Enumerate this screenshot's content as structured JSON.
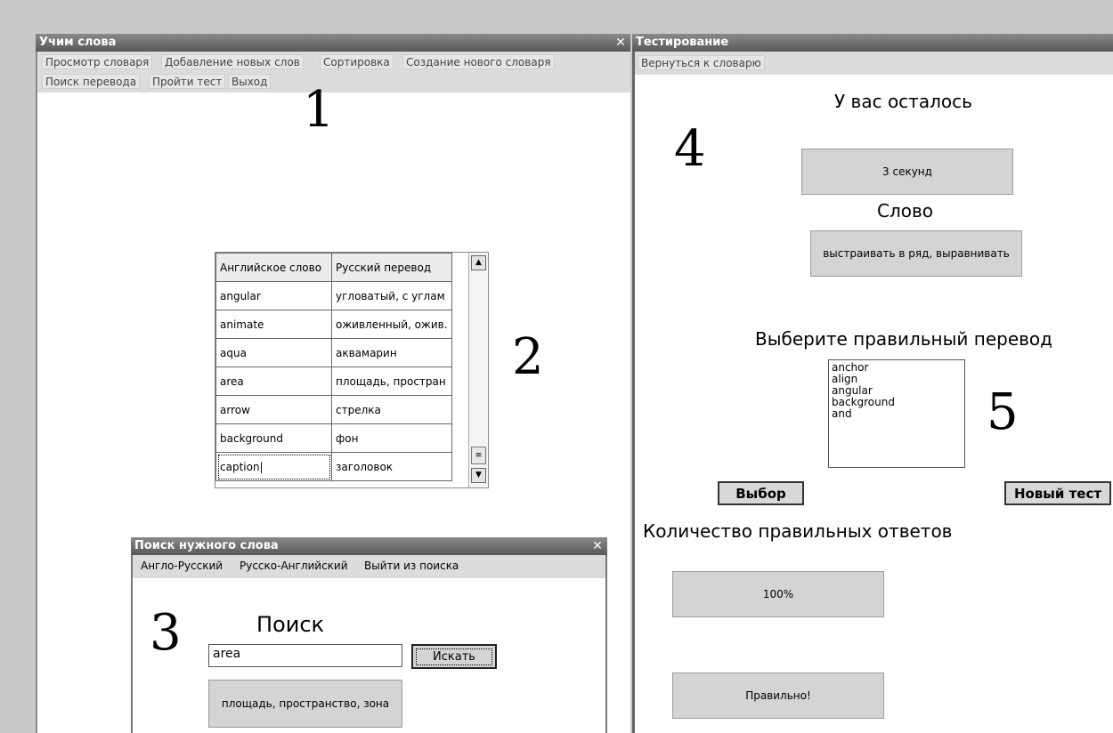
{
  "main_window": {
    "title": "Учим слова",
    "menu": [
      "Просмотр словаря",
      "Добавление новых слов",
      "Сортировка",
      "Создание нового словаря",
      "Поиск перевода",
      "Пройти тест",
      "Выход"
    ]
  },
  "markers": [
    "1",
    "2",
    "3",
    "4",
    "5"
  ],
  "dictionary_table": {
    "headers": [
      "Английское слово",
      "Русский перевод"
    ],
    "rows": [
      [
        "angular",
        "угловатый, с углам"
      ],
      [
        "animate",
        "оживленный, ожив."
      ],
      [
        "aqua",
        "аквамарин"
      ],
      [
        "area",
        "площадь, простран"
      ],
      [
        "arrow",
        "стрелка"
      ],
      [
        "background",
        "фон"
      ],
      [
        "caption|",
        "заголовок"
      ]
    ]
  },
  "search_window": {
    "title": "Поиск нужного слова",
    "menu": [
      "Англо-Русский",
      "Русско-Английский",
      "Выйти из поиска"
    ],
    "heading": "Поиск",
    "input_value": "area",
    "search_button": "Искать",
    "result": "площадь, пространство, зона"
  },
  "test_window": {
    "title": "Тестирование",
    "menu": [
      "Вернуться к словарю"
    ],
    "remaining_label": "У вас осталось",
    "remaining_value": "3 секунд",
    "word_label": "Слово",
    "word_value": "выстраивать в ряд, выравнивать",
    "choose_label": "Выберите правильный перевод",
    "options": [
      "anchor",
      "align",
      "angular",
      "background",
      "and"
    ],
    "select_button": "Выбор",
    "new_test_button": "Новый тест",
    "correct_label": "Количество правильных ответов",
    "correct_value": "100%",
    "verdict": "Правильно!"
  },
  "icons": {
    "close": "close-icon",
    "scroll_up": "scroll-up-icon",
    "scroll_down": "scroll-down-icon"
  }
}
